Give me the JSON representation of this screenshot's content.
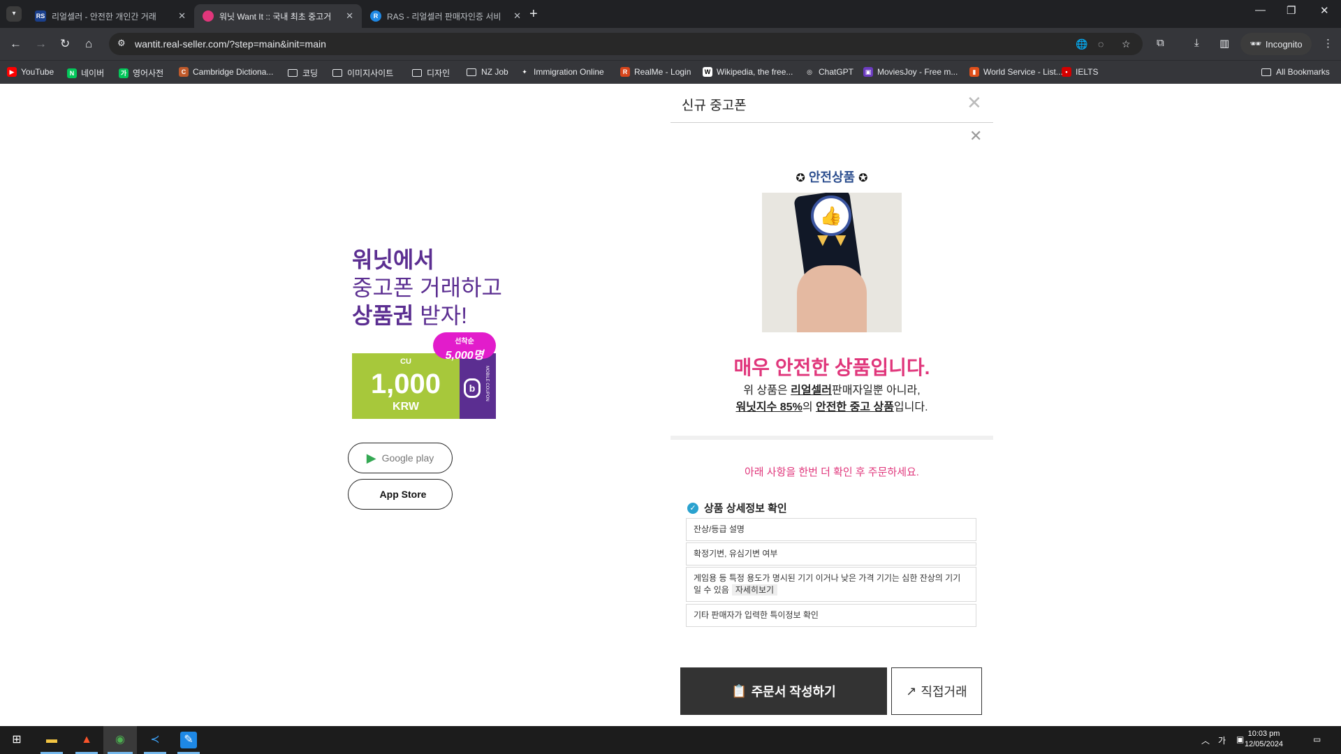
{
  "browser": {
    "tabs": [
      {
        "favicon": "RS",
        "title": "리얼셀러 - 안전한 개인간 거래",
        "active": false
      },
      {
        "favicon": "",
        "title": "워닛 Want It :: 국내 최초 중고거",
        "active": true
      },
      {
        "favicon": "R",
        "title": "RAS - 리얼셀러 판매자인증 서비",
        "active": false
      }
    ],
    "url": "wantit.real-seller.com/?step=main&init=main",
    "incognito_label": "Incognito",
    "bookmarks": [
      {
        "label": "YouTube",
        "icon": "youtube-icon",
        "color": "#ff0000",
        "glyph": "▶"
      },
      {
        "label": "네이버",
        "icon": "naver-icon",
        "color": "#03c75a",
        "glyph": "N"
      },
      {
        "label": "영어사전",
        "icon": "dictionary-icon",
        "color": "#03c75a",
        "glyph": "가"
      },
      {
        "label": "Cambridge Dictiona...",
        "icon": "cambridge-icon",
        "color": "#c05a2b",
        "glyph": "C"
      },
      {
        "label": "코딩",
        "icon": "folder-icon",
        "folder": true
      },
      {
        "label": "이미지사이트",
        "icon": "folder-icon",
        "folder": true
      },
      {
        "label": "디자인",
        "icon": "folder-icon",
        "folder": true
      },
      {
        "label": "NZ Job",
        "icon": "folder-icon",
        "folder": true
      },
      {
        "label": "Immigration Online",
        "icon": "fern-icon",
        "color": "#35363a",
        "glyph": "✦"
      },
      {
        "label": "RealMe - Login",
        "icon": "realme-icon",
        "color": "#d8461c",
        "glyph": "R"
      },
      {
        "label": "Wikipedia, the free...",
        "icon": "wikipedia-icon",
        "color": "#fff",
        "glyph": "W"
      },
      {
        "label": "ChatGPT",
        "icon": "chatgpt-icon",
        "color": "#35363a",
        "glyph": "◎"
      },
      {
        "label": "MoviesJoy - Free m...",
        "icon": "moviesjoy-icon",
        "color": "#6c3cc1",
        "glyph": "▣"
      },
      {
        "label": "World Service - List...",
        "icon": "bbc-icon",
        "color": "#e0501b",
        "glyph": "▮"
      },
      {
        "label": "IELTS",
        "icon": "ielts-icon",
        "color": "#d40000",
        "glyph": "•"
      }
    ],
    "all_bookmarks_label": "All Bookmarks"
  },
  "promo": {
    "line1": "워닛에서",
    "line2": "중고폰 거래하고",
    "line3_bold": "상품권",
    "line3_rest": " 받자!",
    "coupon": {
      "brand": "CU",
      "amount": "1,000",
      "currency": "KRW",
      "badge_small": "선착순",
      "badge_large": "5,000명",
      "side_text": "MOBILE COUPON"
    },
    "google_play": "Google play",
    "app_store": "App Store"
  },
  "modal": {
    "title": "신규 중고폰",
    "safe_label": "안전상품",
    "headline": "매우 안전한 상품입니다.",
    "desc1_pre": "위 상품은 ",
    "desc1_brand": "리얼셀러",
    "desc1_post": "판매자일뿐 아니라,",
    "desc2_index": "워닛지수 85%",
    "desc2_mid": "의 ",
    "desc2_safe": "안전한 중고 상품",
    "desc2_post": "입니다.",
    "notice": "아래 사항을 한번 더 확인 후 주문하세요.",
    "check_title": "상품 상세정보 확인",
    "check_items": [
      "잔상/등급 설명",
      "확정기변, 유심기변 여부",
      "게임용 등 특정 용도가 명시된 기기 이거나 낮은 가격 기기는 심한 잔상의 기기 일 수 있음",
      "기타 판매자가 입력한 특이정보 확인"
    ],
    "check_more": "자세히보기",
    "order_button": "주문서 작성하기",
    "direct_button": "직접거래"
  },
  "taskbar": {
    "ime": "가",
    "time": "10:03 pm",
    "date": "12/05/2024"
  },
  "colors": {
    "brand_purple": "#5b2e91",
    "accent_pink": "#e0367b",
    "coupon_green": "#a7c83b",
    "badge_magenta": "#e21ccb"
  }
}
